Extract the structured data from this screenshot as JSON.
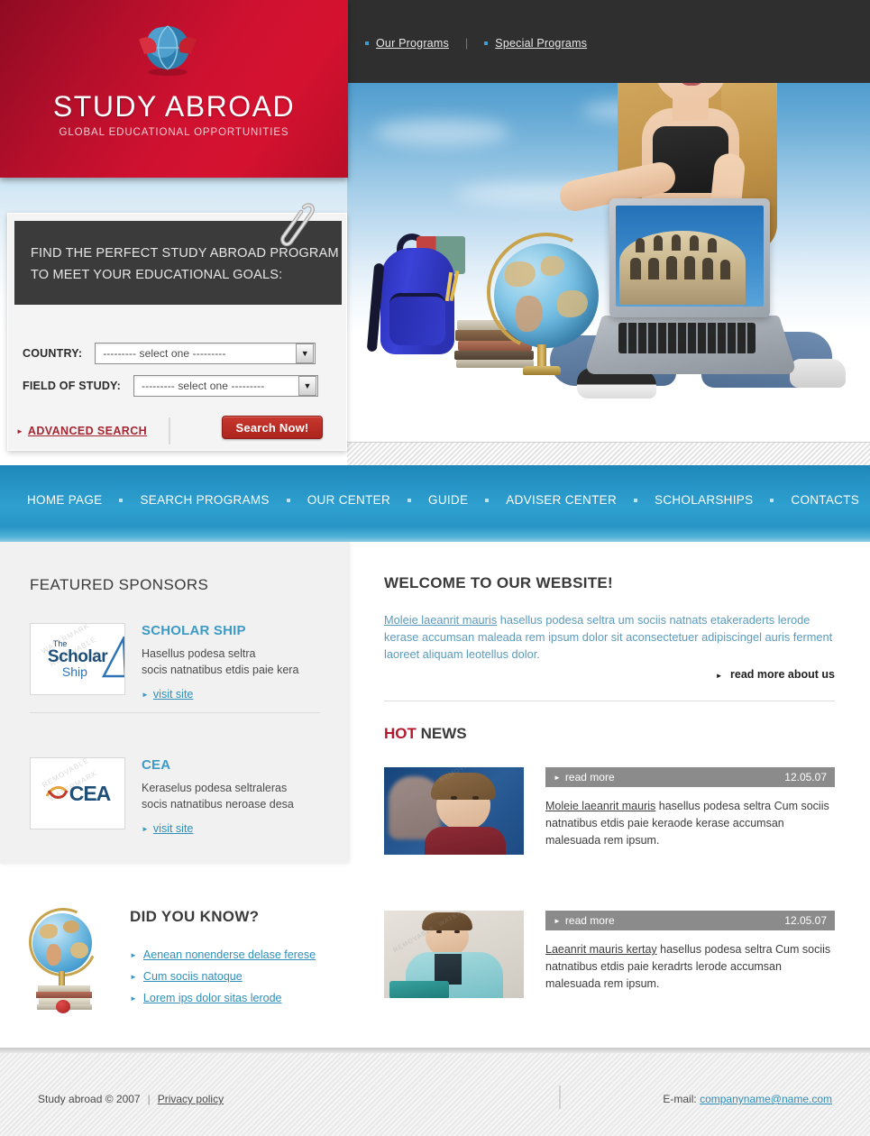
{
  "brand": {
    "title": "STUDY ABROAD",
    "tagline": "GLOBAL EDUCATIONAL OPPORTUNITIES",
    "logo_icon": "globe-ribbon-icon",
    "red": "#cf1130",
    "blue": "#2ea0d0"
  },
  "top_nav": {
    "items": [
      {
        "label": "Our Programs"
      },
      {
        "label": "Special Programs"
      }
    ],
    "separator": "|"
  },
  "search_panel": {
    "heading": "FIND THE PERFECT STUDY ABROAD PROGRAM TO MEET YOUR EDUCATIONAL GOALS:",
    "heading_line1": "FIND THE PERFECT STUDY ABROAD PROGRAM",
    "heading_line2": "TO MEET YOUR EDUCATIONAL GOALS:",
    "country": {
      "label": "COUNTRY:",
      "value": "---------  select one  ---------",
      "placeholder": "---------  select one  ---------"
    },
    "field_of_study": {
      "label": "FIELD OF STUDY:",
      "value": "---------  select one  ---------",
      "placeholder": "---------  select one  ---------"
    },
    "advanced_search": "ADVANCED SEARCH",
    "search_button": "Search Now!",
    "clip_icon": "paperclip-icon"
  },
  "main_nav": {
    "items": [
      {
        "label": "HOME PAGE"
      },
      {
        "label": "SEARCH PROGRAMS"
      },
      {
        "label": "OUR  CENTER"
      },
      {
        "label": "GUIDE"
      },
      {
        "label": "ADVISER CENTER"
      },
      {
        "label": "SCHOLARSHIPS"
      },
      {
        "label": "CONTACTS"
      }
    ]
  },
  "sidebar": {
    "title": "FEATURED SPONSORS",
    "sponsors": [
      {
        "name": "SCHOLAR SHIP",
        "logo_text_top": "The",
        "logo_text_main": "Scholar",
        "logo_text_sub": "Ship",
        "watermark": "WATERMARK REMOVABLE",
        "desc_line1": "Hasellus podesa seltra",
        "desc_line2": "socis natnatibus etdis paie kera",
        "link": "visit site"
      },
      {
        "name": "CEA",
        "logo_text_main": "CEA",
        "watermark": "REMOVABLE WATERMARK",
        "desc_line1": "Keraselus podesa seltraleras",
        "desc_line2": "socis natnatibus neroase desa",
        "link": "visit site"
      }
    ]
  },
  "did_you_know": {
    "title": "DID YOU KNOW?",
    "icon": "globe-on-books-icon",
    "links": [
      "Aenean nonenderse delase ferese",
      "Cum sociis natoque",
      "Lorem ips dolor sitas lerode"
    ]
  },
  "welcome": {
    "title": "WELCOME TO OUR WEBSITE!",
    "link_text": "Moleie laeanrit mauris",
    "body": " hasellus podesa seltra um sociis natnats etakeraderts lerode kerase accumsan maleada rem ipsum dolor sit aconsectetuer adipiscingel auris ferment laoreet aliquam leotellus dolor.",
    "read_more": "read more about us"
  },
  "hot_news": {
    "title_hot": "HOT",
    "title_news": " NEWS",
    "items": [
      {
        "read_more": "read more",
        "date": "12.05.07",
        "link_text": "Moleie laeanrit mauris",
        "body": " hasellus podesa seltra Cum sociis natnatibus etdis paie keraode kerase accumsan malesuada rem ipsum.",
        "thumb": "girl-student-photo"
      },
      {
        "read_more": "read more",
        "date": "12.05.07",
        "link_text": "Laeanrit mauris kertay",
        "body": " hasellus podesa seltra Cum sociis natnatibus etdis paie keradrts lerode accumsan malesuada rem ipsum.",
        "thumb": "boy-student-photo"
      }
    ]
  },
  "footer": {
    "copyright": "Study abroad  © 2007",
    "separator": "|",
    "privacy": "Privacy policy",
    "email_label": "E-mail:",
    "email": "companyname@name.com"
  }
}
